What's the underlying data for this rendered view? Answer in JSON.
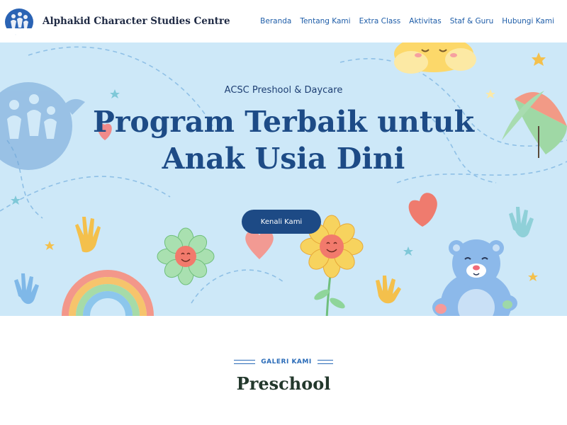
{
  "header": {
    "site_title": "Alphakid Character Studies Centre",
    "logo": "alphakid-logo",
    "nav": [
      "Beranda",
      "Tentang Kami",
      "Extra Class",
      "Aktivitas",
      "Staf & Guru",
      "Hubungi Kami"
    ]
  },
  "hero": {
    "subtitle": "ACSC Preshool & Daycare",
    "title": "Program Terbaik untuk Anak Usia Dini",
    "button_label": "Kenali Kami",
    "background_color": "#cde8f8",
    "button_color": "#1d4a85"
  },
  "gallery": {
    "label": "GALERI KAMI",
    "title": "Preschool"
  },
  "colors": {
    "title_blue": "#1d4b86",
    "nav_blue": "#1e5da8"
  }
}
